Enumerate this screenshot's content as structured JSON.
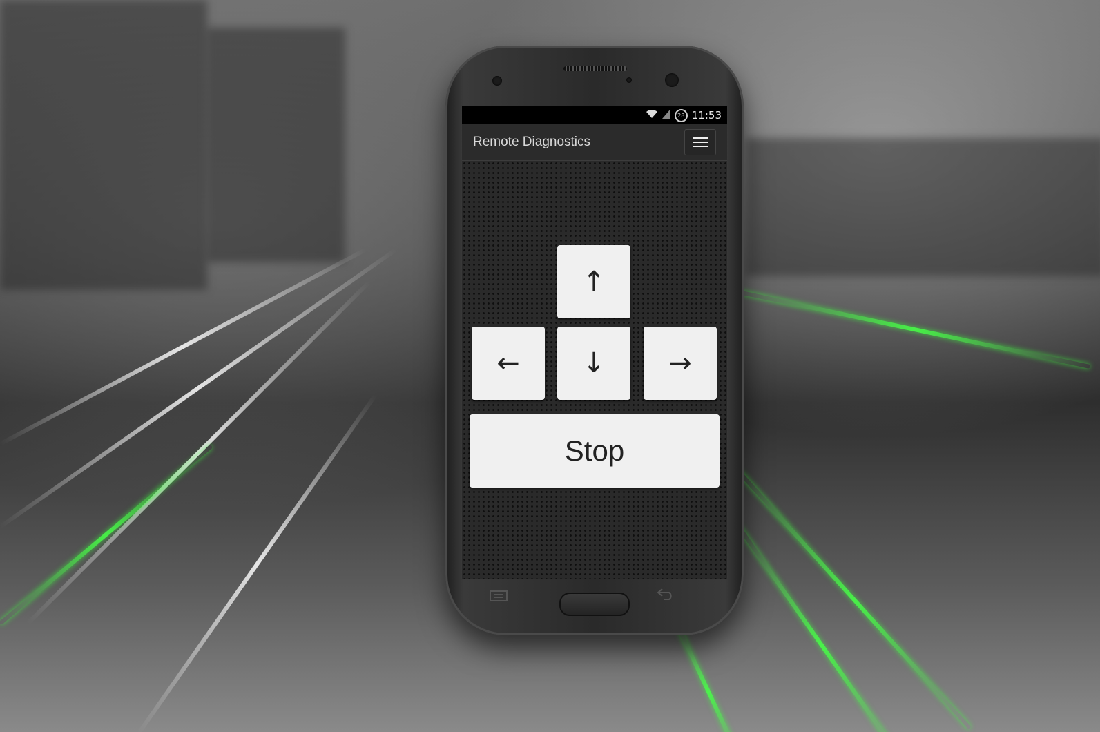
{
  "status_bar": {
    "wifi_icon": "wifi-icon",
    "signal_icon": "signal-icon",
    "battery_level": "28",
    "time": "11:53"
  },
  "app_bar": {
    "title": "Remote Diagnostics",
    "menu_icon": "hamburger-menu-icon"
  },
  "controls": {
    "up": "↑",
    "left": "←",
    "down": "↓",
    "right": "→",
    "stop": "Stop"
  },
  "hardware_keys": {
    "menu_icon": "menu-key-icon",
    "home_icon": "home-button",
    "back_icon": "back-key-icon"
  },
  "colors": {
    "accent_green": "#46ff46",
    "key_background": "#f0f0f0"
  }
}
